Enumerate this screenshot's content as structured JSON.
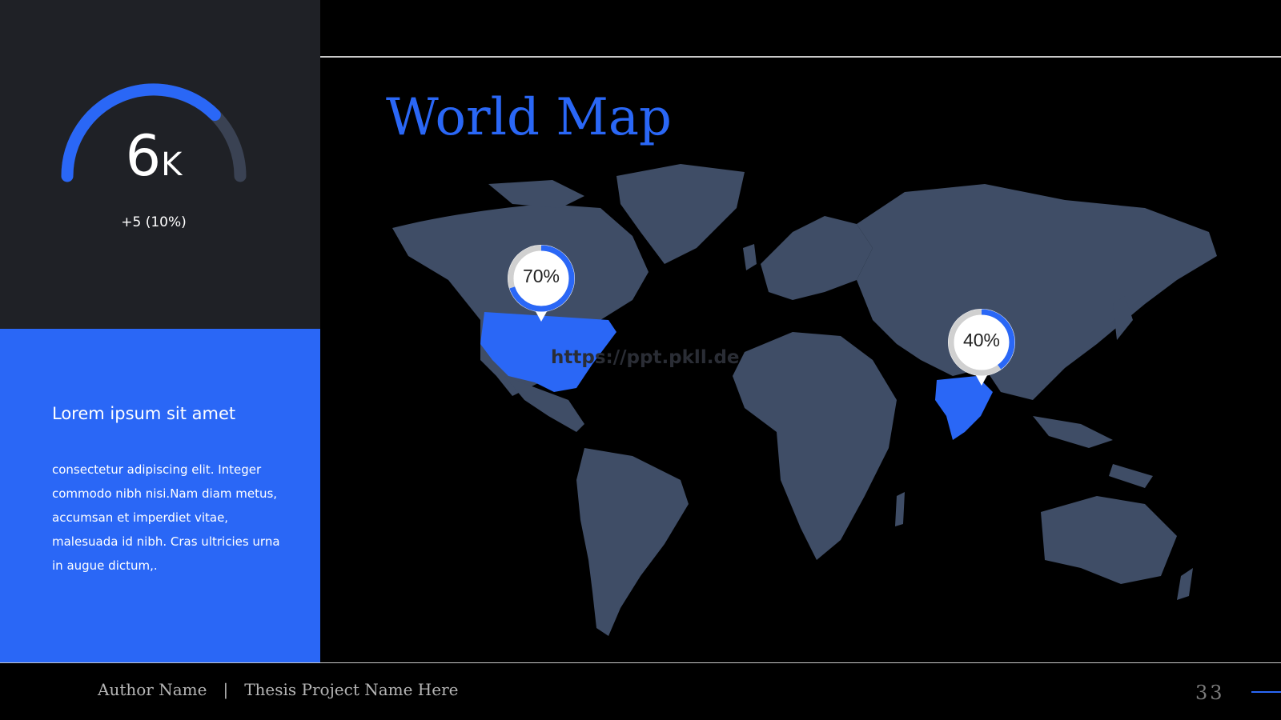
{
  "gauge": {
    "value": "6",
    "unit": "K",
    "delta": "+5 (10%)",
    "fill_fraction": 0.75
  },
  "card": {
    "title": "Lorem ipsum sit amet",
    "body": "consectetur adipiscing elit. Integer commodo nibh nisi.Nam diam metus, accumsan et imperdiet vitae, malesuada id nibh. Cras ultricies urna in augue dictum,."
  },
  "slide": {
    "title": "World Map",
    "watermark": "https://ppt.pkll.de"
  },
  "pins": [
    {
      "label": "70%",
      "fraction": 0.7,
      "region": "United States"
    },
    {
      "label": "40%",
      "fraction": 0.4,
      "region": "India"
    }
  ],
  "footer": {
    "author": "Author Name",
    "separator": "|",
    "project": "Thesis Project Name Here",
    "page": "33"
  },
  "colors": {
    "accent": "#2a67f6",
    "land": "#3f4d66",
    "panel": "#1f2126",
    "background": "#000000"
  }
}
